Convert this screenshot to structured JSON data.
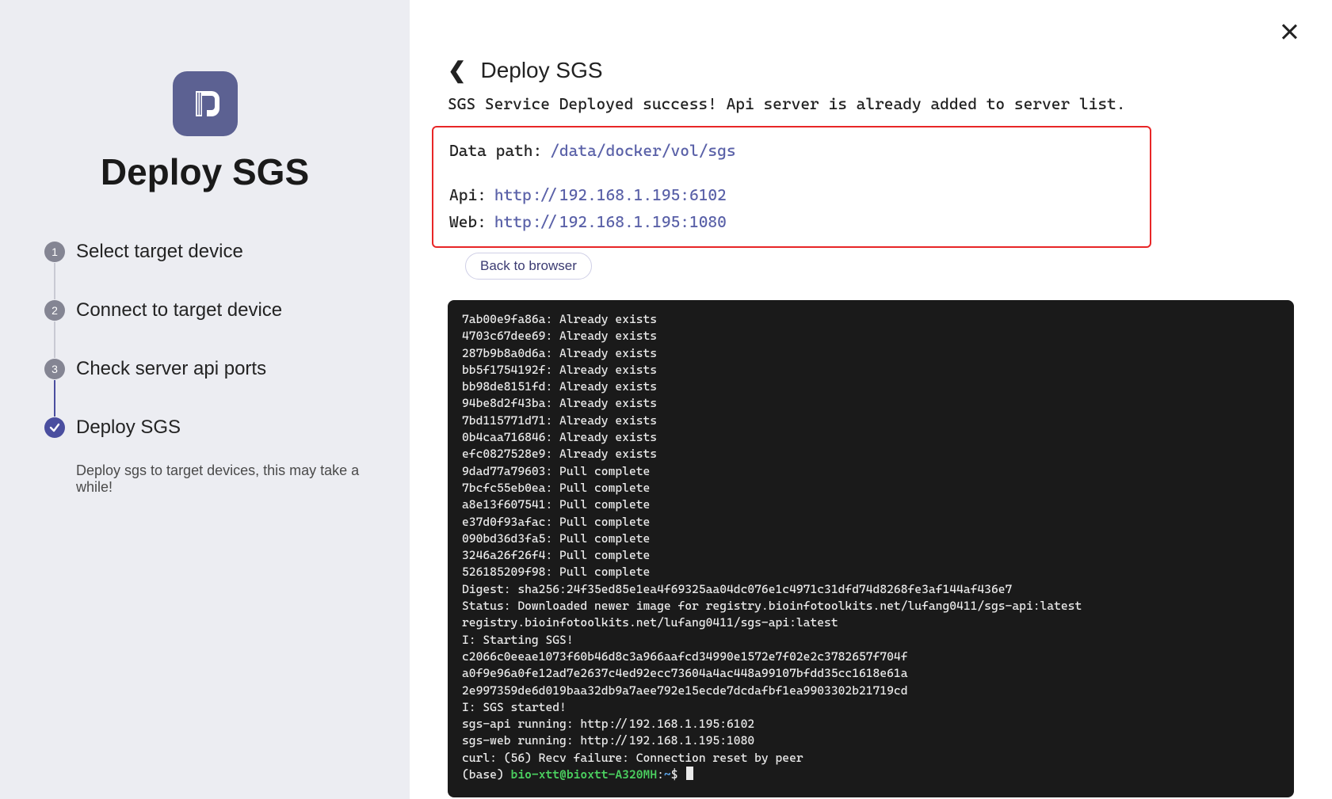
{
  "sidebar": {
    "title": "Deploy SGS",
    "steps": [
      {
        "num": "1",
        "label": "Select target device"
      },
      {
        "num": "2",
        "label": "Connect to target device"
      },
      {
        "num": "3",
        "label": "Check server api ports"
      },
      {
        "num": "",
        "label": "Deploy SGS"
      }
    ],
    "help": "Deploy sgs to target devices, this may take a while!"
  },
  "main": {
    "title": "Deploy SGS",
    "success_message": "SGS Service Deployed success! Api server is already added to server list.",
    "info": {
      "data_path_label": "Data path:",
      "data_path_value": "/data/docker/vol/sgs",
      "api_label": "Api:",
      "api_value": "http://192.168.1.195:6102",
      "web_label": "Web:",
      "web_value": "http://192.168.1.195:1080"
    },
    "back_button": "Back to browser"
  },
  "terminal": {
    "lines": [
      "7ab00e9fa86a: Already exists",
      "4703c67dee69: Already exists",
      "287b9b8a0d6a: Already exists",
      "bb5f1754192f: Already exists",
      "bb98de8151fd: Already exists",
      "94be8d2f43ba: Already exists",
      "7bd115771d71: Already exists",
      "0b4caa716846: Already exists",
      "efc0827528e9: Already exists",
      "9dad77a79603: Pull complete",
      "7bcfc55eb0ea: Pull complete",
      "a8e13f607541: Pull complete",
      "e37d0f93afac: Pull complete",
      "090bd36d3fa5: Pull complete",
      "3246a26f26f4: Pull complete",
      "526185209f98: Pull complete",
      "Digest: sha256:24f35ed85e1ea4f69325aa04dc076e1c4971c31dfd74d8268fe3af144af436e7",
      "Status: Downloaded newer image for registry.bioinfotoolkits.net/lufang0411/sgs-api:latest",
      "registry.bioinfotoolkits.net/lufang0411/sgs-api:latest",
      "I: Starting SGS!",
      "c2066c0eeae1073f60b46d8c3a966aafcd34990e1572e7f02e2c3782657f704f",
      "a0f9e96a0fe12ad7e2637c4ed92ecc73604a4ac448a99107bfdd35cc1618e61a",
      "2e997359de6d019baa32db9a7aee792e15ecde7dcdafbf1ea9903302b21719cd",
      "I: SGS started!",
      "sgs-api running: http://192.168.1.195:6102",
      "sgs-web running: http://192.168.1.195:1080",
      "curl: (56) Recv failure: Connection reset by peer"
    ],
    "prompt_prefix": "(base) ",
    "prompt_userhost": "bio-xtt@bioxtt-A320MH",
    "prompt_colon": ":",
    "prompt_tilde": "~",
    "prompt_dollar": "$ "
  }
}
